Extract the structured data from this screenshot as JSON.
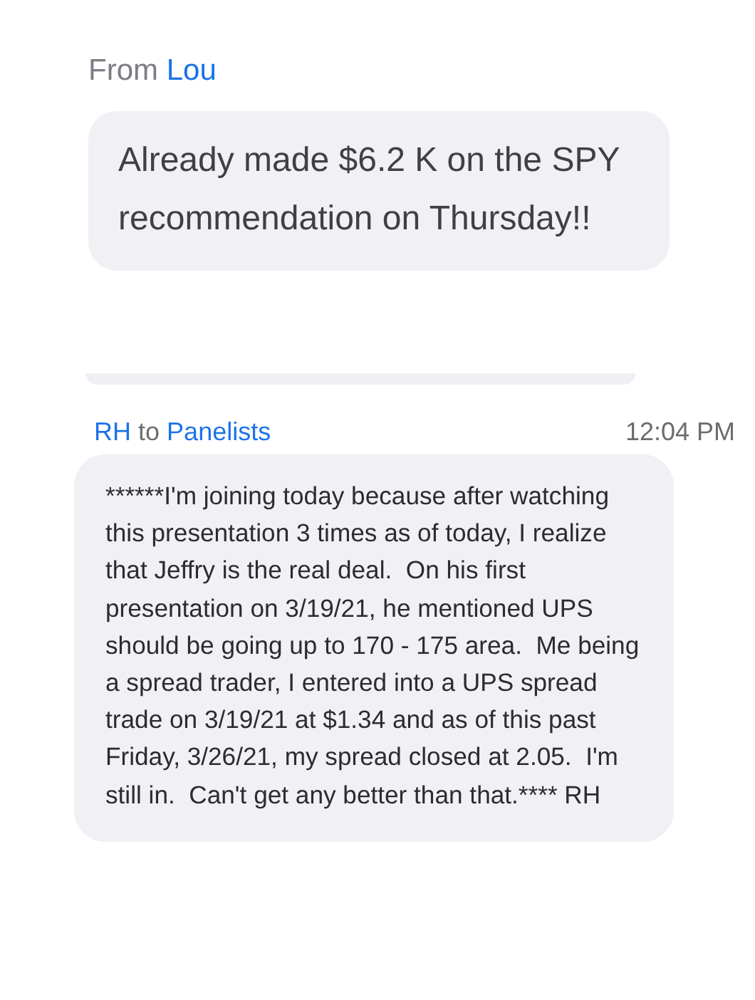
{
  "messages": [
    {
      "kind": "from",
      "prefix": "From",
      "sender": "Lou",
      "text": "Already made $6.2 K on the SPY recommendation on Thursday!!"
    },
    {
      "kind": "partial"
    },
    {
      "kind": "to",
      "sender": "RH",
      "connector": "to",
      "recipient": "Panelists",
      "time": "12:04 PM",
      "text": "******I'm joining today because after watching this presentation 3 times as of today, I realize that Jeffry is the real deal.  On his first presentation on 3/19/21, he mentioned UPS should be going up to 170 - 175 area.  Me being a spread trader, I entered into a UPS spread trade on 3/19/21 at $1.34 and as of this past Friday, 3/26/21, my spread closed at 2.05.  I'm still in.  Can't get any better than that.**** RH"
    }
  ]
}
